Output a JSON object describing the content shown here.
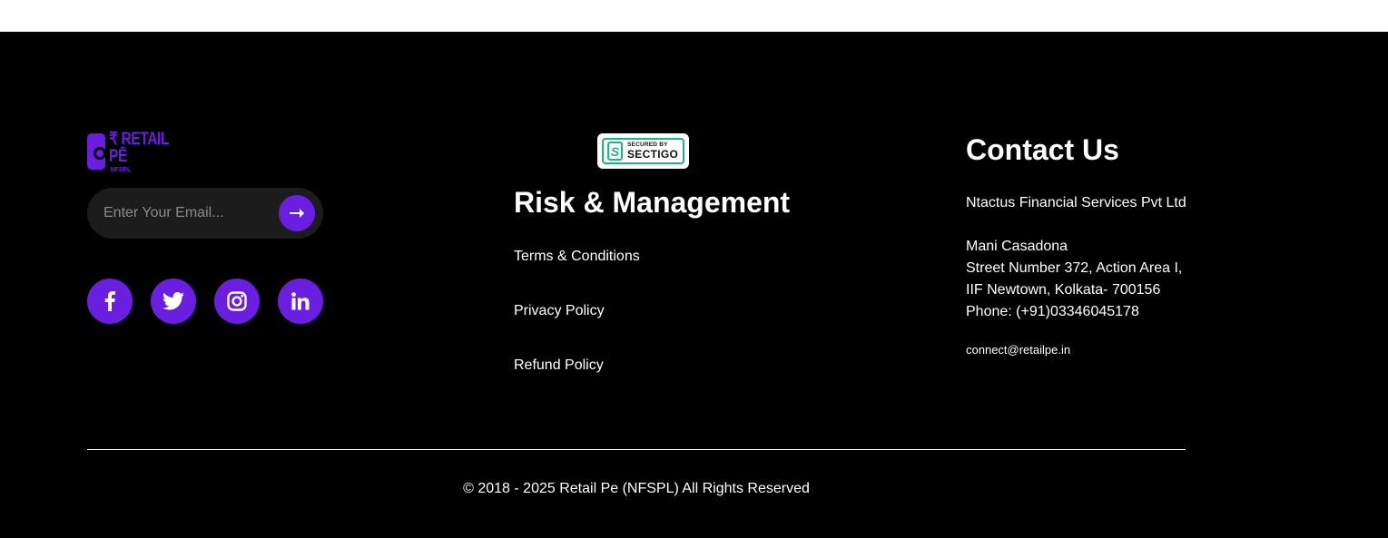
{
  "brand": {
    "name": "₹ RETAIL PĒ",
    "sub": "NFSPL"
  },
  "newsletter": {
    "placeholder": "Enter Your Email...",
    "submit_icon": "arrow-right-icon"
  },
  "socials": [
    {
      "name": "facebook",
      "icon": "facebook-icon"
    },
    {
      "name": "twitter",
      "icon": "twitter-icon"
    },
    {
      "name": "instagram",
      "icon": "instagram-icon"
    },
    {
      "name": "linkedin",
      "icon": "linkedin-icon"
    }
  ],
  "badge": {
    "line1": "SECURED BY",
    "line2": "SECTIGO",
    "mark": "S"
  },
  "risk": {
    "title": "Risk & Management",
    "links": [
      "Terms & Conditions",
      "Privacy Policy",
      "Refund Policy"
    ]
  },
  "contact": {
    "title": "Contact Us",
    "company": "Ntactus Financial Services Pvt Ltd",
    "address": [
      "Mani Casadona",
      "Street Number 372, Action Area I,",
      "IIF Newtown, Kolkata- 700156",
      "Phone: (+91)03346045178"
    ],
    "email": "connect@retailpe.in"
  },
  "copyright": "© 2018 - 2025 Retail Pe (NFSPL) All Rights Reserved",
  "colors": {
    "accent": "#6a1ee0",
    "background": "#000000",
    "badge_green": "#1bb57e"
  }
}
